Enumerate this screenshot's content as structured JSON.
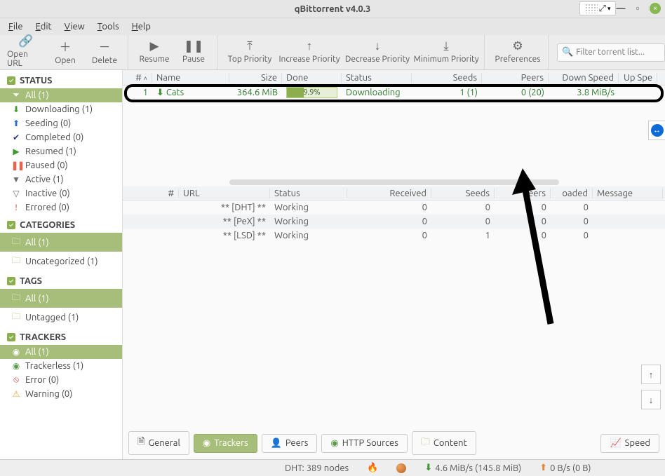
{
  "title": "qBittorrent v4.0.3",
  "menubar": {
    "file": "File",
    "edit": "Edit",
    "view": "View",
    "tools": "Tools",
    "help": "Help"
  },
  "toolbar": {
    "open_url": "Open URL",
    "open": "Open",
    "delete": "Delete",
    "resume": "Resume",
    "pause": "Pause",
    "top": "Top Priority",
    "inc": "Increase Priority",
    "dec": "Decrease Priority",
    "min": "Minimum Priority",
    "prefs": "Preferences",
    "search_placeholder": "Filter torrent list..."
  },
  "sidebar": {
    "status": {
      "header": "STATUS",
      "all": "All (1)",
      "downloading": "Downloading (1)",
      "seeding": "Seeding (0)",
      "completed": "Completed (0)",
      "resumed": "Resumed (1)",
      "paused": "Paused (0)",
      "active": "Active (1)",
      "inactive": "Inactive (0)",
      "errored": "Errored (0)"
    },
    "categories": {
      "header": "CATEGORIES",
      "all": "All (1)",
      "uncat": "Uncategorized (1)"
    },
    "tags": {
      "header": "TAGS",
      "all": "All (1)",
      "untag": "Untagged (1)"
    },
    "trackers": {
      "header": "TRACKERS",
      "all": "All (1)",
      "trackerless": "Trackerless (1)",
      "error": "Error (0)",
      "warning": "Warning (0)"
    }
  },
  "columns": {
    "num": "#",
    "name": "Name",
    "size": "Size",
    "done": "Done",
    "status": "Status",
    "seeds": "Seeds",
    "peers": "Peers",
    "down": "Down Speed",
    "up": "Up Spe"
  },
  "torrents": [
    {
      "num": "1",
      "name": "Cats",
      "size": "364.6 MiB",
      "done": "9.9%",
      "done_pct": 34,
      "status": "Downloading",
      "seeds": "1 (1)",
      "peers": "0 (20)",
      "down": "3.8 MiB/s"
    }
  ],
  "tracker_columns": {
    "num": "#",
    "url": "URL",
    "status": "Status",
    "received": "Received",
    "seeds": "Seeds",
    "peers": "Peers",
    "oaded": "oaded",
    "message": "Message"
  },
  "trackers": [
    {
      "url": "** [DHT] **",
      "status": "Working",
      "received": "0",
      "seeds": "0",
      "peers": "0",
      "oaded": "0"
    },
    {
      "url": "** [PeX] **",
      "status": "Working",
      "received": "0",
      "seeds": "0",
      "peers": "0",
      "oaded": "0"
    },
    {
      "url": "** [LSD] **",
      "status": "Working",
      "received": "0",
      "seeds": "1",
      "peers": "0",
      "oaded": "0"
    }
  ],
  "tabs": {
    "general": "General",
    "trackers": "Trackers",
    "peers": "Peers",
    "http": "HTTP Sources",
    "content": "Content",
    "speed": "Speed"
  },
  "statusbar": {
    "dht": "DHT: 389 nodes",
    "down": "4.6 MiB/s (145.8 MiB)",
    "up": "0 B/s (0 B)"
  }
}
